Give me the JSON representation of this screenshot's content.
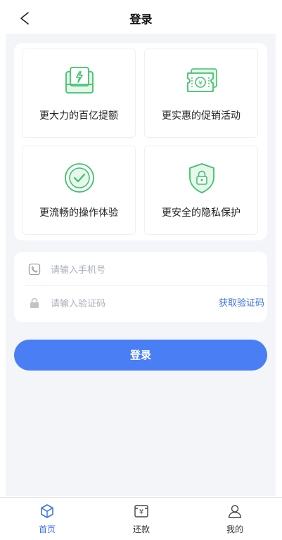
{
  "header": {
    "title": "登录"
  },
  "features": [
    {
      "label": "更大力的百亿提额",
      "icon": "credit-increase-icon"
    },
    {
      "label": "更实惠的促销活动",
      "icon": "coupon-icon"
    },
    {
      "label": "更流畅的操作体验",
      "icon": "check-circle-icon"
    },
    {
      "label": "更安全的隐私保护",
      "icon": "lock-shield-icon"
    }
  ],
  "form": {
    "phone_placeholder": "请输入手机号",
    "code_placeholder": "请输入验证码",
    "get_code_label": "获取验证码"
  },
  "login_button_label": "登录",
  "tabbar": {
    "tabs": [
      {
        "label": "首页",
        "icon": "home-cube-icon",
        "active": true
      },
      {
        "label": "还款",
        "icon": "yuan-repay-icon",
        "active": false
      },
      {
        "label": "我的",
        "icon": "user-icon",
        "active": false
      }
    ]
  },
  "colors": {
    "accent": "#4a7ef5",
    "link": "#3a73e8",
    "icon_green": "#3cc36b",
    "background": "#f4f5f9"
  }
}
